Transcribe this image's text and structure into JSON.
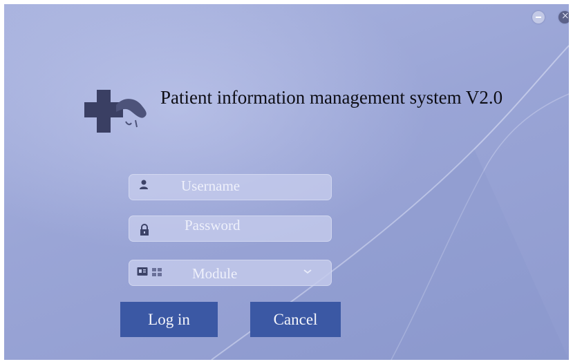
{
  "window": {
    "minimize_icon": "minimize-icon",
    "close_icon": "close-icon"
  },
  "header": {
    "logo_icon": "medical-cross-logo-icon",
    "title": "Patient information management system V2.0"
  },
  "form": {
    "username": {
      "placeholder": "Username",
      "icon": "user-icon"
    },
    "password": {
      "placeholder": "Password",
      "icon": "lock-icon"
    },
    "module": {
      "selected": "Module",
      "icons": [
        "id-card-icon",
        "module-grid-icon"
      ],
      "dropdown_icon": "chevron-down-icon"
    }
  },
  "buttons": {
    "login_label": "Log in",
    "cancel_label": "Cancel"
  },
  "colors": {
    "background": "#9aa5d6",
    "field": "#c4cbec",
    "button": "#3b58a4",
    "title": "#0d0d14"
  }
}
